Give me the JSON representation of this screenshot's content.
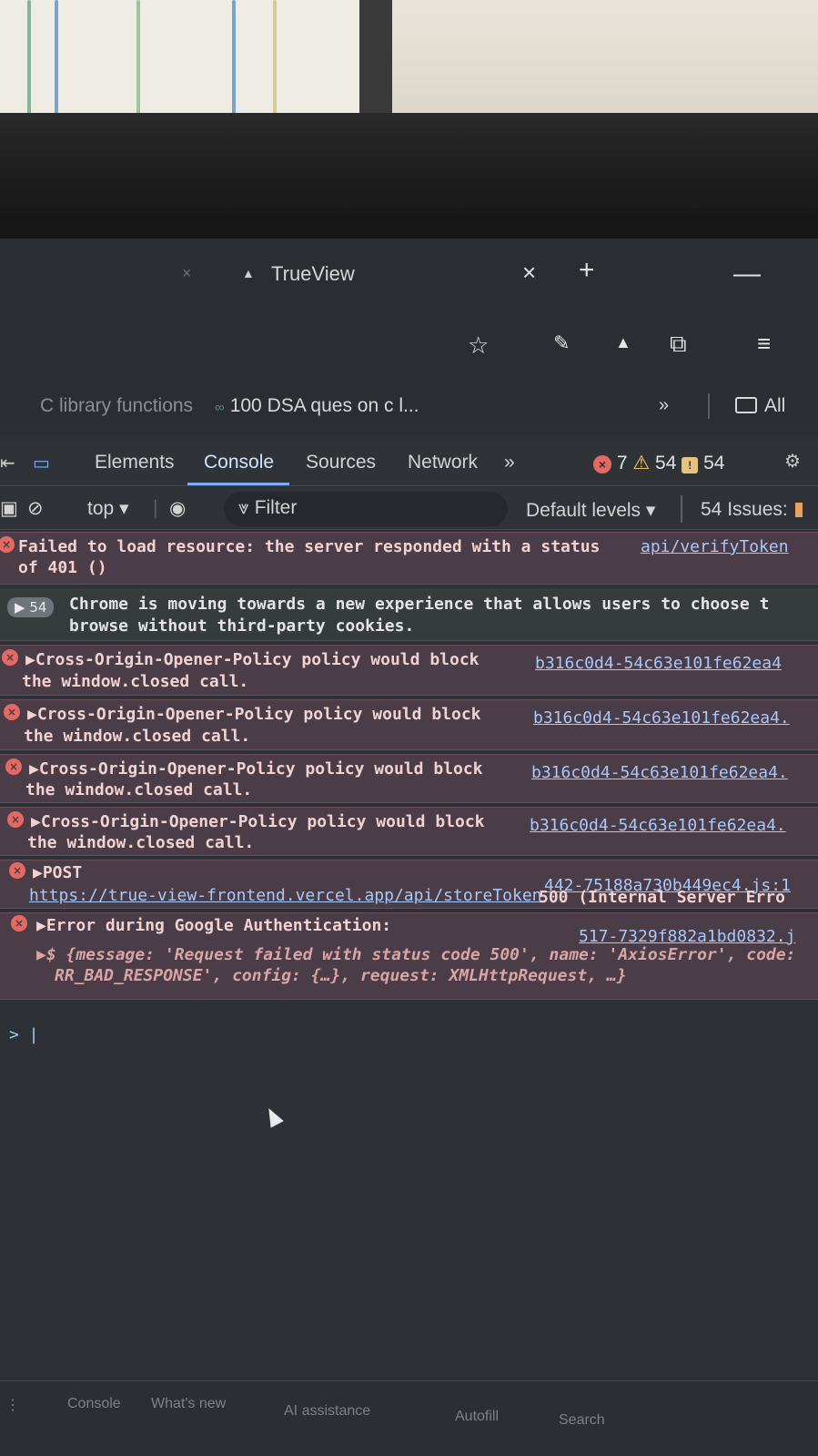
{
  "browser": {
    "tab_title": "TrueView",
    "tab_close": "×",
    "new_tab": "+",
    "minimize": "—",
    "icons": [
      "star-icon",
      "extensions-icon",
      "puzzle-icon",
      "media-icon"
    ]
  },
  "bookmarks": {
    "items": [
      {
        "label": "C library functions"
      },
      {
        "label": "100 DSA ques on c l..."
      }
    ],
    "more": "»",
    "all_label": "All"
  },
  "devtools": {
    "tabs": [
      "Elements",
      "Console",
      "Sources",
      "Network"
    ],
    "active_tab": "Console",
    "more_tabs": "»",
    "error_count": "7",
    "warning_count": "54",
    "info_count": "54",
    "context": "top ▾",
    "filter_placeholder": "Filter",
    "levels": "Default levels ▾",
    "issues": "54 Issues:"
  },
  "console": {
    "messages": [
      {
        "type": "error",
        "text1": "Failed to load resource: the server responded with a status",
        "text2": "of 401 ()",
        "source": "api/verifyToken"
      },
      {
        "type": "info",
        "count": "54",
        "text1": "Chrome is moving towards a new experience that allows users to choose t",
        "text2": "browse without third-party cookies."
      },
      {
        "type": "error",
        "text1": "▶Cross-Origin-Opener-Policy policy would block",
        "text2": "the window.closed call.",
        "source": "b316c0d4-54c63e101fe62ea4"
      },
      {
        "type": "error",
        "text1": "▶Cross-Origin-Opener-Policy policy would block",
        "text2": "the window.closed call.",
        "source": "b316c0d4-54c63e101fe62ea4."
      },
      {
        "type": "error",
        "text1": "▶Cross-Origin-Opener-Policy policy would block",
        "text2": "the window.closed call.",
        "source": "b316c0d4-54c63e101fe62ea4."
      },
      {
        "type": "error",
        "text1": "▶Cross-Origin-Opener-Policy policy would block",
        "text2": "the window.closed call.",
        "source": "b316c0d4-54c63e101fe62ea4."
      },
      {
        "type": "error",
        "text1": "▶POST",
        "url": "https://true-view-frontend.vercel.app/api/storeToken",
        "status": " 500 (Internal Server Erro",
        "source": "442-75188a730b449ec4.js:1"
      },
      {
        "type": "error",
        "text1": "▶Error during Google Authentication:",
        "source": "517-7329f882a1bd0832.j",
        "text2": "▶$ {message: 'Request failed with status code 500', name: 'AxiosError', code:",
        "text3": "RR_BAD_RESPONSE', config: {…}, request: XMLHttpRequest, …}"
      }
    ],
    "prompt": "> |"
  },
  "drawer": {
    "tabs": [
      "Console",
      "What's new",
      "AI assistance",
      "Autofill",
      "Search"
    ]
  }
}
